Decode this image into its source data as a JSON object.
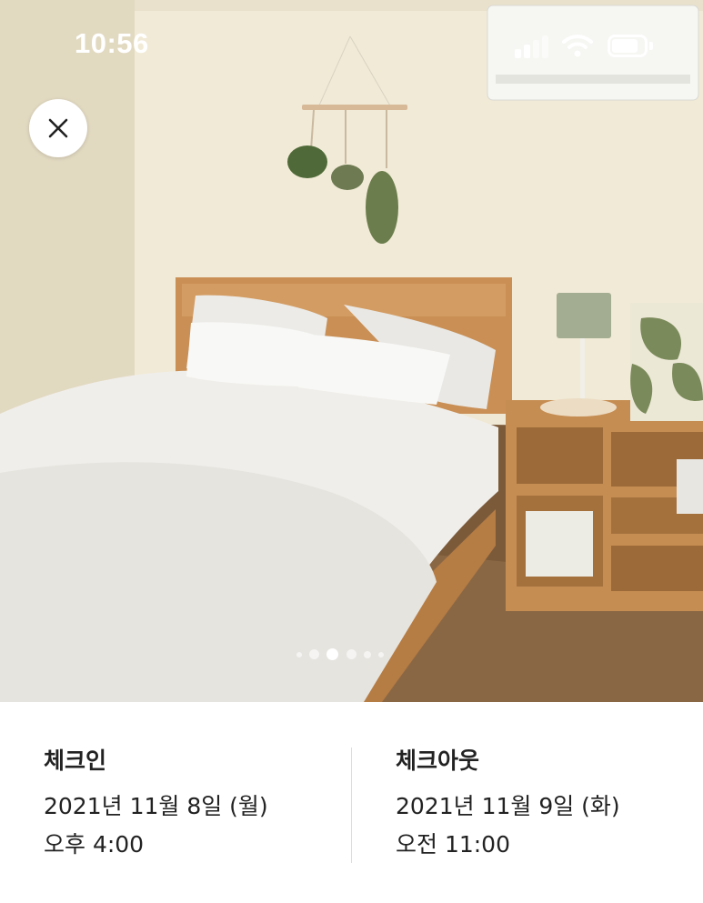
{
  "status_bar": {
    "time": "10:56",
    "icons": [
      "signal-icon",
      "wifi-icon",
      "battery-icon"
    ]
  },
  "photo": {
    "close_icon": "close-icon",
    "carousel": {
      "count": 5,
      "active_index": 2
    }
  },
  "checkin": {
    "title": "체크인",
    "date": "2021년 11월 8일 (월)",
    "time": "오후 4:00"
  },
  "checkout": {
    "title": "체크아웃",
    "date": "2021년 11월 9일 (화)",
    "time": "오전 11:00"
  },
  "colors": {
    "text": "#222222",
    "divider": "#dddddd",
    "background": "#ffffff"
  }
}
